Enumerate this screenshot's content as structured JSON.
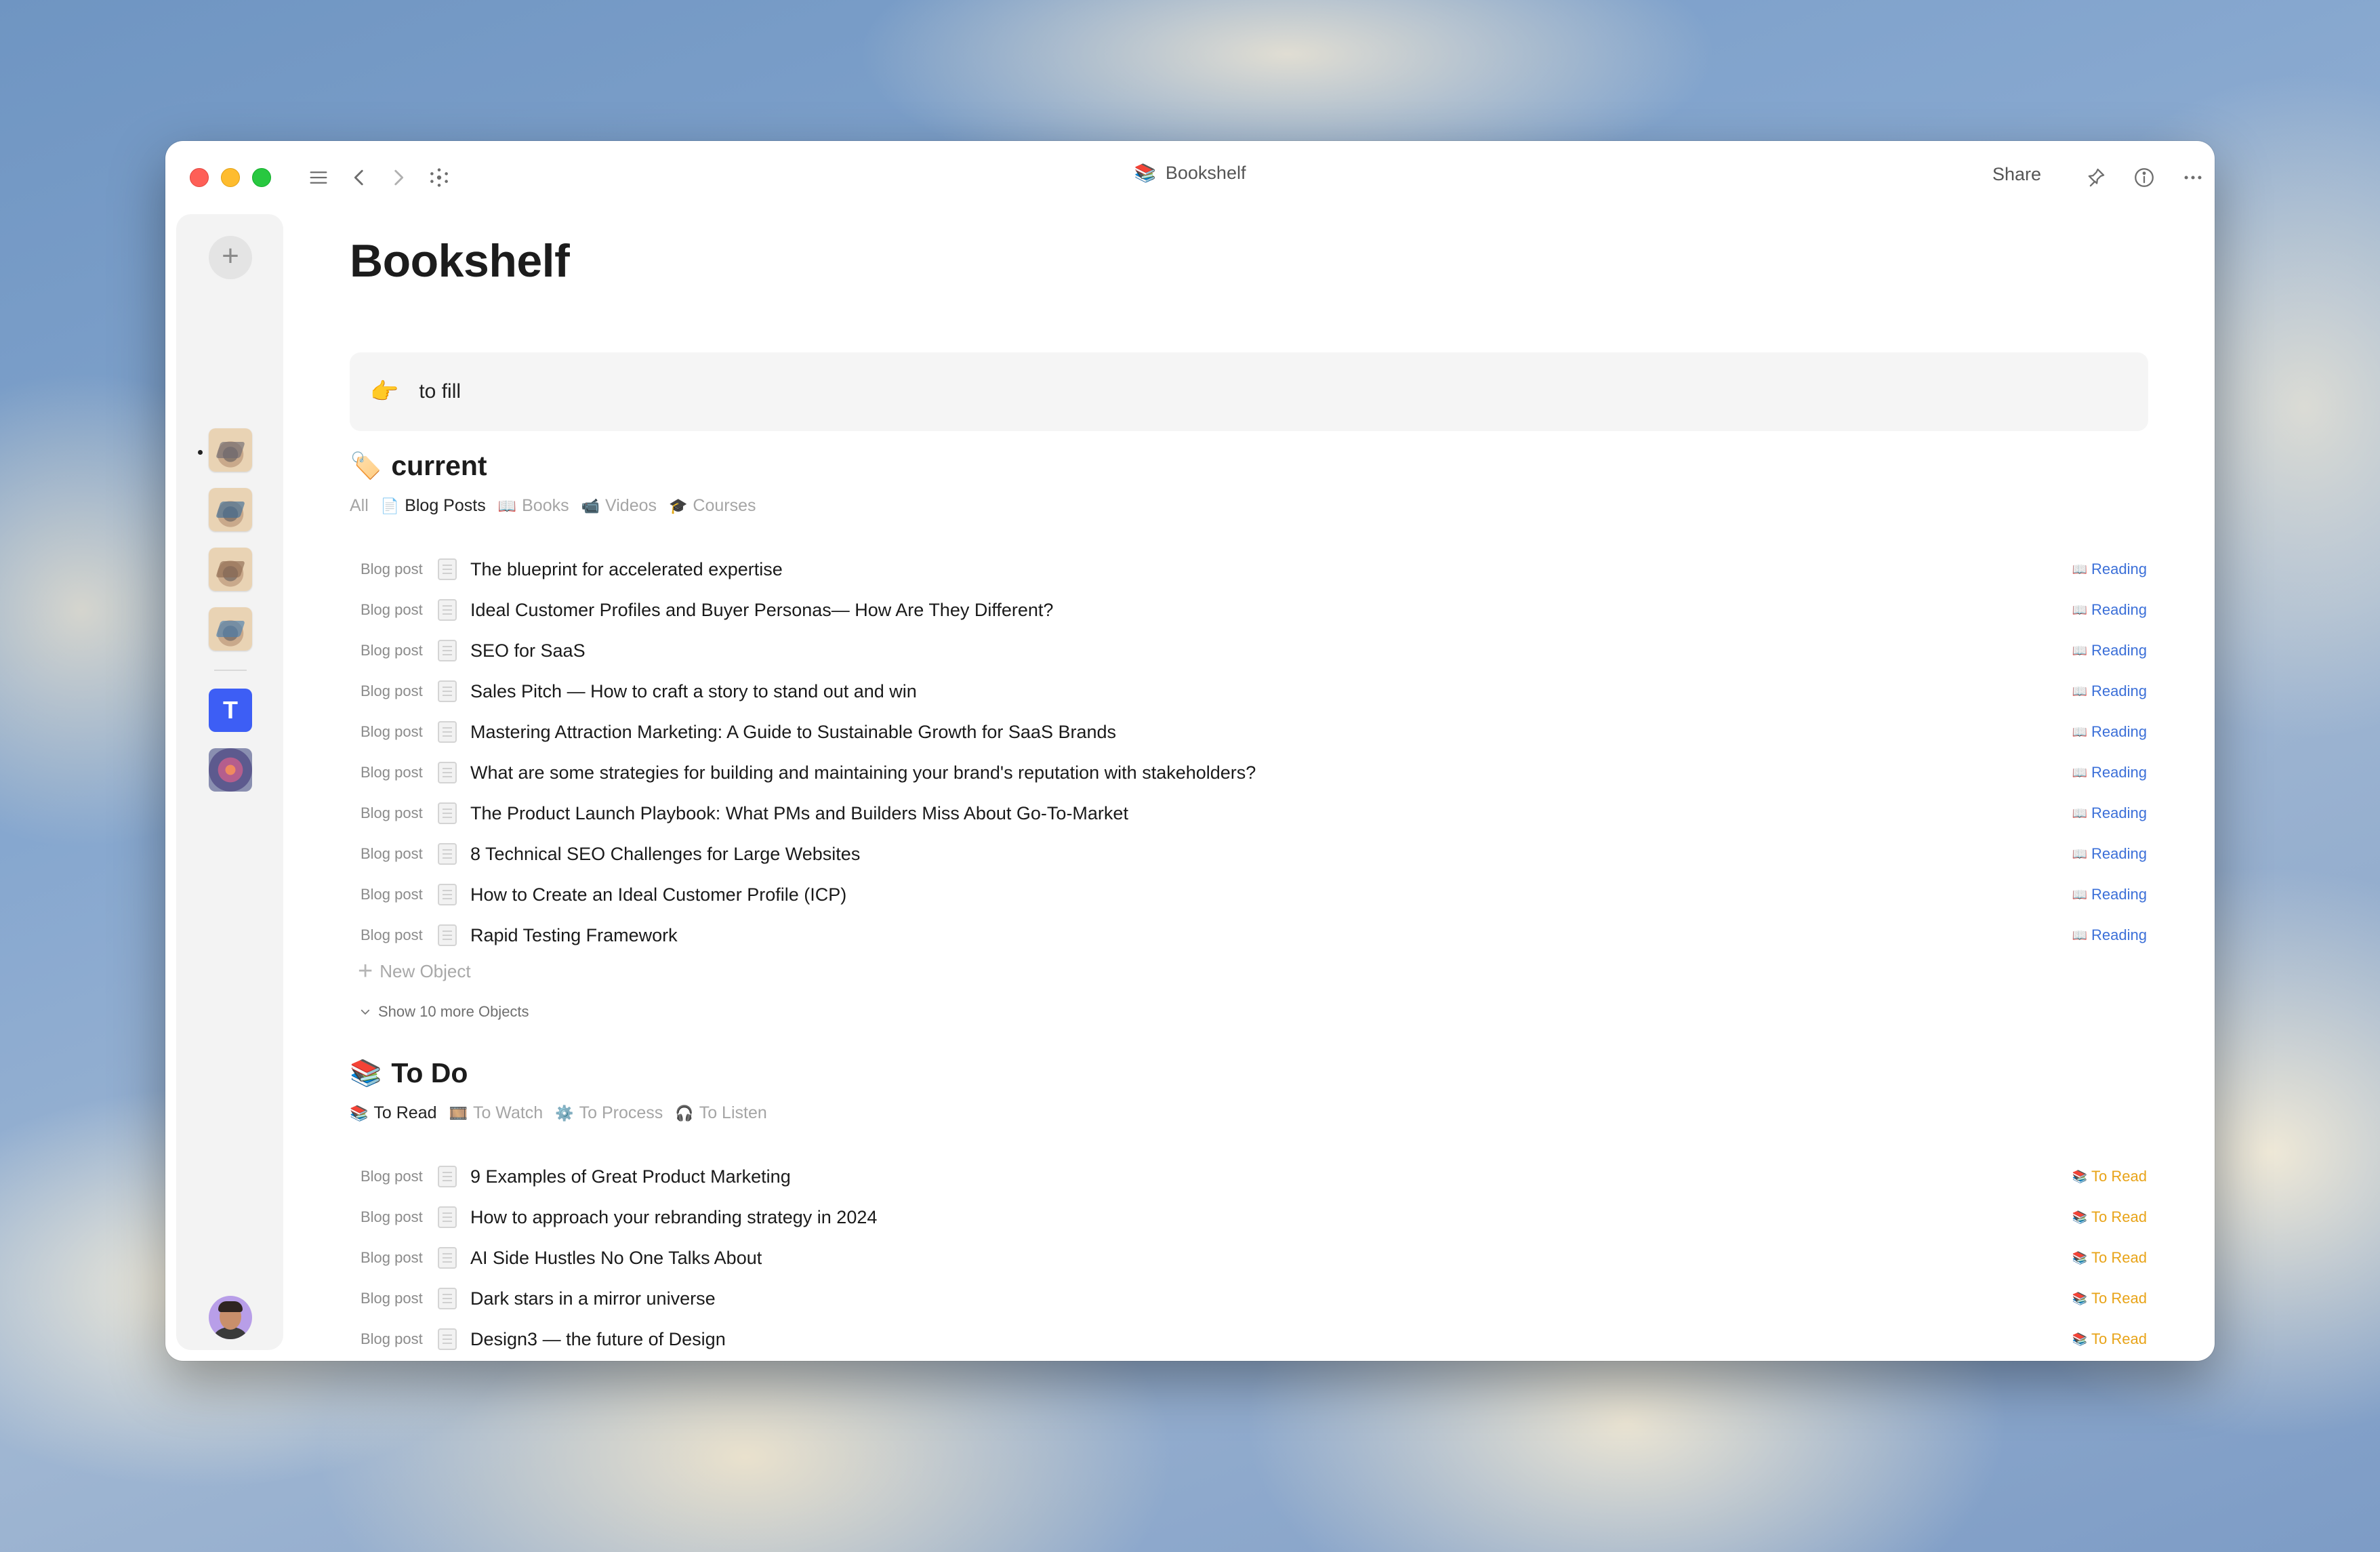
{
  "window": {
    "title": "Bookshelf",
    "title_icon": "books-emoji",
    "title_emoji": "📚",
    "share_label": "Share"
  },
  "page": {
    "title": "Bookshelf",
    "callout": {
      "emoji": "👉",
      "text": "to fill"
    }
  },
  "sections": [
    {
      "title": "current",
      "emoji": "🏷️",
      "views": [
        {
          "label": "All",
          "emoji": "",
          "active": false
        },
        {
          "label": "Blog Posts",
          "emoji": "📄",
          "active": true
        },
        {
          "label": "Books",
          "emoji": "📖",
          "active": false
        },
        {
          "label": "Videos",
          "emoji": "📹",
          "active": false
        },
        {
          "label": "Courses",
          "emoji": "🎓",
          "active": false
        }
      ],
      "status_emoji": "📖",
      "rows": [
        {
          "type": "Blog post",
          "name": "The blueprint for accelerated expertise",
          "status": "Reading"
        },
        {
          "type": "Blog post",
          "name": "Ideal Customer Profiles and Buyer Personas— How Are They Different?",
          "status": "Reading"
        },
        {
          "type": "Blog post",
          "name": "SEO for SaaS",
          "status": "Reading"
        },
        {
          "type": "Blog post",
          "name": "Sales Pitch — How to craft a story to stand out and win",
          "status": "Reading"
        },
        {
          "type": "Blog post",
          "name": "Mastering Attraction Marketing: A Guide to Sustainable Growth for SaaS Brands",
          "status": "Reading"
        },
        {
          "type": "Blog post",
          "name": "What are some strategies for building and maintaining your brand's reputation with stakeholders?",
          "status": "Reading"
        },
        {
          "type": "Blog post",
          "name": "The Product Launch Playbook: What PMs and Builders Miss About Go-To-Market",
          "status": "Reading"
        },
        {
          "type": "Blog post",
          "name": "8 Technical SEO Challenges for Large Websites",
          "status": "Reading"
        },
        {
          "type": "Blog post",
          "name": "How to Create an Ideal Customer Profile (ICP)",
          "status": "Reading"
        },
        {
          "type": "Blog post",
          "name": "Rapid Testing Framework",
          "status": "Reading"
        }
      ],
      "new_object_label": "New Object",
      "show_more_label": "Show 10 more Objects"
    },
    {
      "title": "To Do",
      "emoji": "📚",
      "views": [
        {
          "label": "To Read",
          "emoji": "📚",
          "active": true
        },
        {
          "label": "To Watch",
          "emoji": "🎞️",
          "active": false
        },
        {
          "label": "To Process",
          "emoji": "⚙️",
          "active": false
        },
        {
          "label": "To Listen",
          "emoji": "🎧",
          "active": false
        }
      ],
      "status_emoji": "📚",
      "rows": [
        {
          "type": "Blog post",
          "name": "9 Examples of Great Product Marketing",
          "status": "To Read"
        },
        {
          "type": "Blog post",
          "name": "How to approach your rebranding strategy in 2024",
          "status": "To Read"
        },
        {
          "type": "Blog post",
          "name": "AI Side Hustles No One Talks About",
          "status": "To Read"
        },
        {
          "type": "Blog post",
          "name": "Dark stars in a mirror universe",
          "status": "To Read"
        },
        {
          "type": "Blog post",
          "name": "Design3 — the future of Design",
          "status": "To Read"
        }
      ]
    }
  ],
  "colors": {
    "reading_status": "#3b6fd8",
    "to_read_status": "#e8a317",
    "space_t_tile": "#3d5ef5"
  }
}
